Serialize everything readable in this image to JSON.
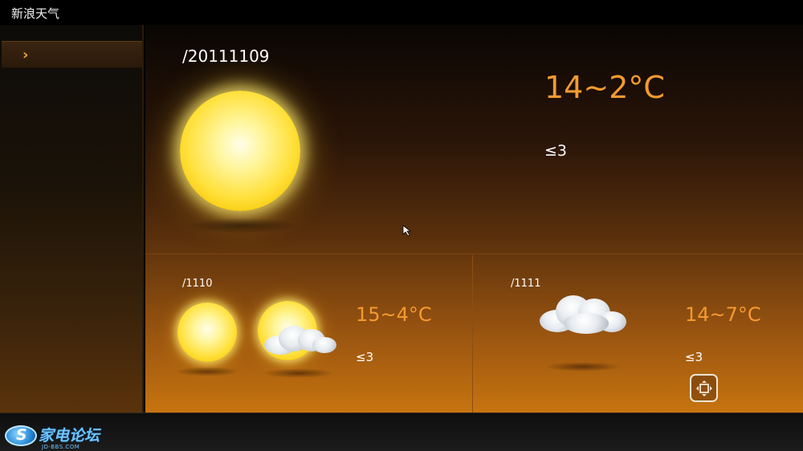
{
  "app": {
    "title": "新浪天气"
  },
  "sidebar": {
    "items": [
      {
        "label": ""
      }
    ]
  },
  "today": {
    "date": "/20111109",
    "temp": "14~2°C",
    "wind": "≤3"
  },
  "forecast": [
    {
      "date": "/1110",
      "temp": "15~4°C",
      "wind": "≤3",
      "icons": [
        "sun-icon",
        "sun-cloud-icon"
      ]
    },
    {
      "date": "/1111",
      "temp": "14~7°C",
      "wind": "≤3",
      "icons": [
        "cloud-icon"
      ]
    }
  ],
  "watermark": {
    "text": "家电论坛",
    "sub": "JD-BBS.COM"
  },
  "colors": {
    "accent": "#f59a30",
    "background_top": "#0a0604",
    "background_bottom": "#c77410"
  }
}
